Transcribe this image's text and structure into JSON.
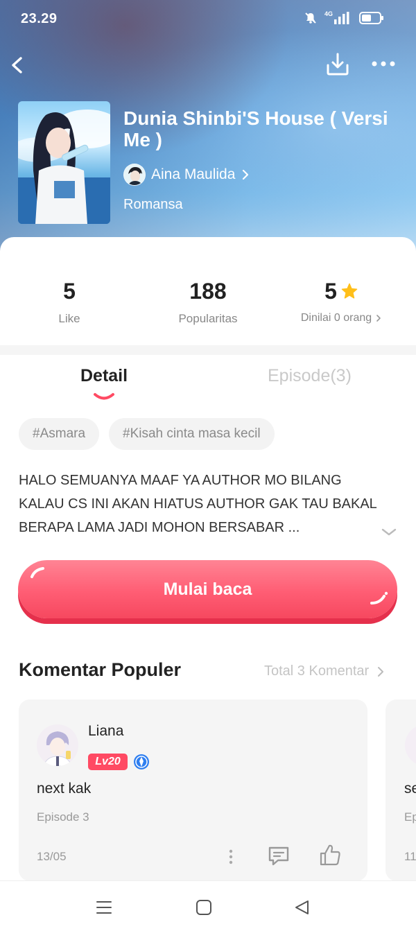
{
  "status_bar": {
    "time": "23.29",
    "network": "4G",
    "icons": [
      "mute-icon",
      "signal-icon",
      "battery-icon"
    ]
  },
  "header": {
    "icons": [
      "back-arrow-icon",
      "download-icon",
      "more-dots-icon"
    ]
  },
  "book": {
    "title": "Dunia Shinbi'S House ( Versi Me )",
    "author": "Aina Maulida",
    "genre": "Romansa"
  },
  "stats": {
    "like_value": "5",
    "like_label": "Like",
    "popularity_value": "188",
    "popularity_label": "Popularitas",
    "rating_value": "5",
    "rating_label": "Dinilai 0 orang"
  },
  "tabs": {
    "detail": "Detail",
    "episodes": "Episode(3)"
  },
  "tags": [
    "#Asmara",
    "#Kisah cinta masa kecil"
  ],
  "synopsis": "HALO SEMUANYA MAAF YA AUTHOR MO BILANG KALAU CS INI AKAN HIATUS AUTHOR GAK TAU BAKAL BERAPA LAMA JADI MOHON BERSABAR ...",
  "read_button": "Mulai baca",
  "comments": {
    "section_title": "Komentar Populer",
    "total_label": "Total 3 Komentar",
    "items": [
      {
        "user": "Liana",
        "level": "Lv20",
        "text": "next kak",
        "episode": "Episode 3",
        "date": "13/05"
      },
      {
        "text": "se",
        "episode": "Ep",
        "date": "11"
      }
    ]
  },
  "colors": {
    "accent": "#ff5d74",
    "star": "#ffbf1a",
    "verify": "#2f7ff0"
  }
}
